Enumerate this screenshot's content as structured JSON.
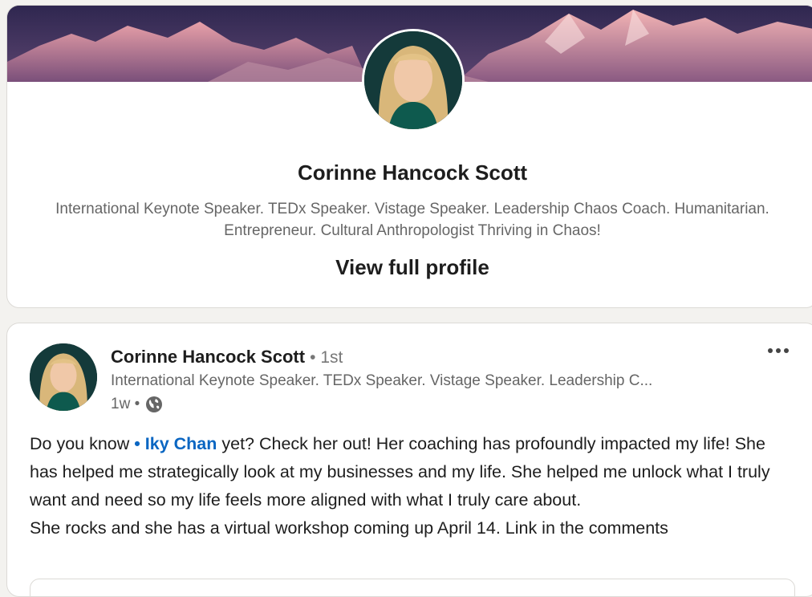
{
  "profile_card": {
    "name": "Corinne Hancock Scott",
    "headline_line1": "International Keynote Speaker. TEDx Speaker. Vistage Speaker. Leadership Chaos Coach. Humanitarian.",
    "headline_line2": "Entrepreneur. Cultural Anthropologist Thriving in Chaos!",
    "view_profile_label": "View full profile"
  },
  "post": {
    "author_name": "Corinne Hancock Scott",
    "degree": "• 1st",
    "author_headline": "International Keynote Speaker. TEDx Speaker. Vistage Speaker. Leadership C...",
    "time": "1w •",
    "text_before_mention": "Do you know ",
    "mention": "• Iky Chan",
    "text_after_mention": " yet? Check her out! Her coaching has profoundly impacted my life! She has helped me strategically look at my businesses and my life. She helped me unlock what I truly want and need so my life feels more aligned with what I truly care about.",
    "text_line2": "She rocks and she has a virtual workshop coming up April 14. Link in the comments"
  },
  "icons": {
    "globe": "globe-icon",
    "more": "more-options-icon",
    "banner": "mountain-banner"
  },
  "colors": {
    "link": "#0a66c2",
    "muted_text": "#666666",
    "background": "#f3f2ef"
  }
}
